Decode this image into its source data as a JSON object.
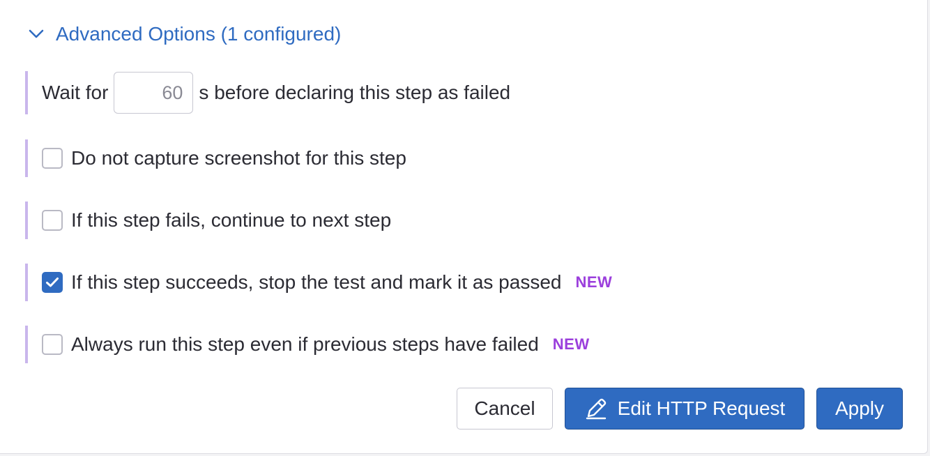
{
  "advanced": {
    "header_label": "Advanced Options (1 configured)",
    "expanded": true
  },
  "wait": {
    "prefix": "Wait for",
    "value": "60",
    "suffix": "s before declaring this step as failed"
  },
  "options": [
    {
      "label": "Do not capture screenshot for this step",
      "checked": false,
      "badge": ""
    },
    {
      "label": "If this step fails, continue to next step",
      "checked": false,
      "badge": ""
    },
    {
      "label": "If this step succeeds, stop the test and mark it as passed",
      "checked": true,
      "badge": "NEW"
    },
    {
      "label": "Always run this step even if previous steps have failed",
      "checked": false,
      "badge": "NEW"
    }
  ],
  "buttons": {
    "cancel": "Cancel",
    "edit_http": "Edit HTTP Request",
    "apply": "Apply"
  },
  "colors": {
    "accent": "#2f6bc1",
    "badge": "#9b3fdc",
    "option_bar": "#c9b6ec"
  },
  "icons": {
    "chevron": "chevron-down-icon",
    "check": "checkmark-icon",
    "pencil": "pencil-icon"
  }
}
